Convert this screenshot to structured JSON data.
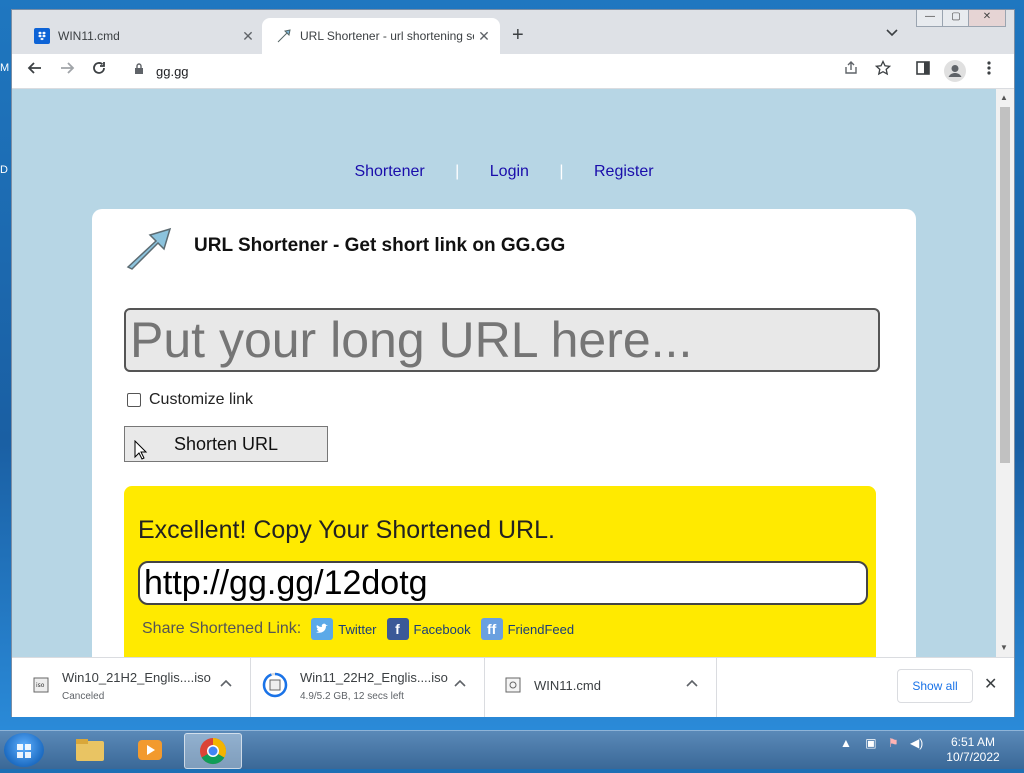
{
  "browser": {
    "tabs": [
      {
        "title": "WIN11.cmd",
        "close": "✕"
      },
      {
        "title": "URL Shortener - url shortening se",
        "close": "✕"
      }
    ],
    "new_tab": "+",
    "tab_menu": "⌄",
    "window_controls": {
      "minimize": "—",
      "maximize": "▢",
      "close": "✕"
    },
    "address": "gg.gg"
  },
  "page": {
    "nav": [
      {
        "label": "Shortener"
      },
      {
        "label": "Login"
      },
      {
        "label": "Register"
      }
    ],
    "nav_separator": "|",
    "title": "URL Shortener - Get short link on GG.GG",
    "input_placeholder": "Put your long URL here...",
    "customize_label": "Customize link",
    "shorten_button": "Shorten URL",
    "result": {
      "heading": "Excellent! Copy Your Shortened URL.",
      "short_url": "http://gg.gg/12dotg",
      "share_label": "Share Shortened Link:",
      "share_items": [
        {
          "label": "Twitter",
          "icon": "twitter-icon",
          "color": "#5ba9e8"
        },
        {
          "label": "Facebook",
          "icon": "facebook-icon",
          "color": "#3b5998"
        },
        {
          "label": "FriendFeed",
          "icon": "friendfeed-icon",
          "color": "#6aa0e0"
        }
      ]
    },
    "colors": {
      "page_bg": "#b7d6e5",
      "result_bg": "#ffea00",
      "link": "#1a0dab"
    }
  },
  "downloads": {
    "items": [
      {
        "name": "Win10_21H2_Englis....iso",
        "status": "Canceled"
      },
      {
        "name": "Win11_22H2_Englis....iso",
        "status": "4.9/5.2 GB, 12 secs left",
        "progress": 0.94
      },
      {
        "name": "WIN11.cmd",
        "status": ""
      }
    ],
    "show_all": "Show all",
    "close": "✕"
  },
  "taskbar": {
    "time": "6:51 AM",
    "date": "10/7/2022"
  }
}
